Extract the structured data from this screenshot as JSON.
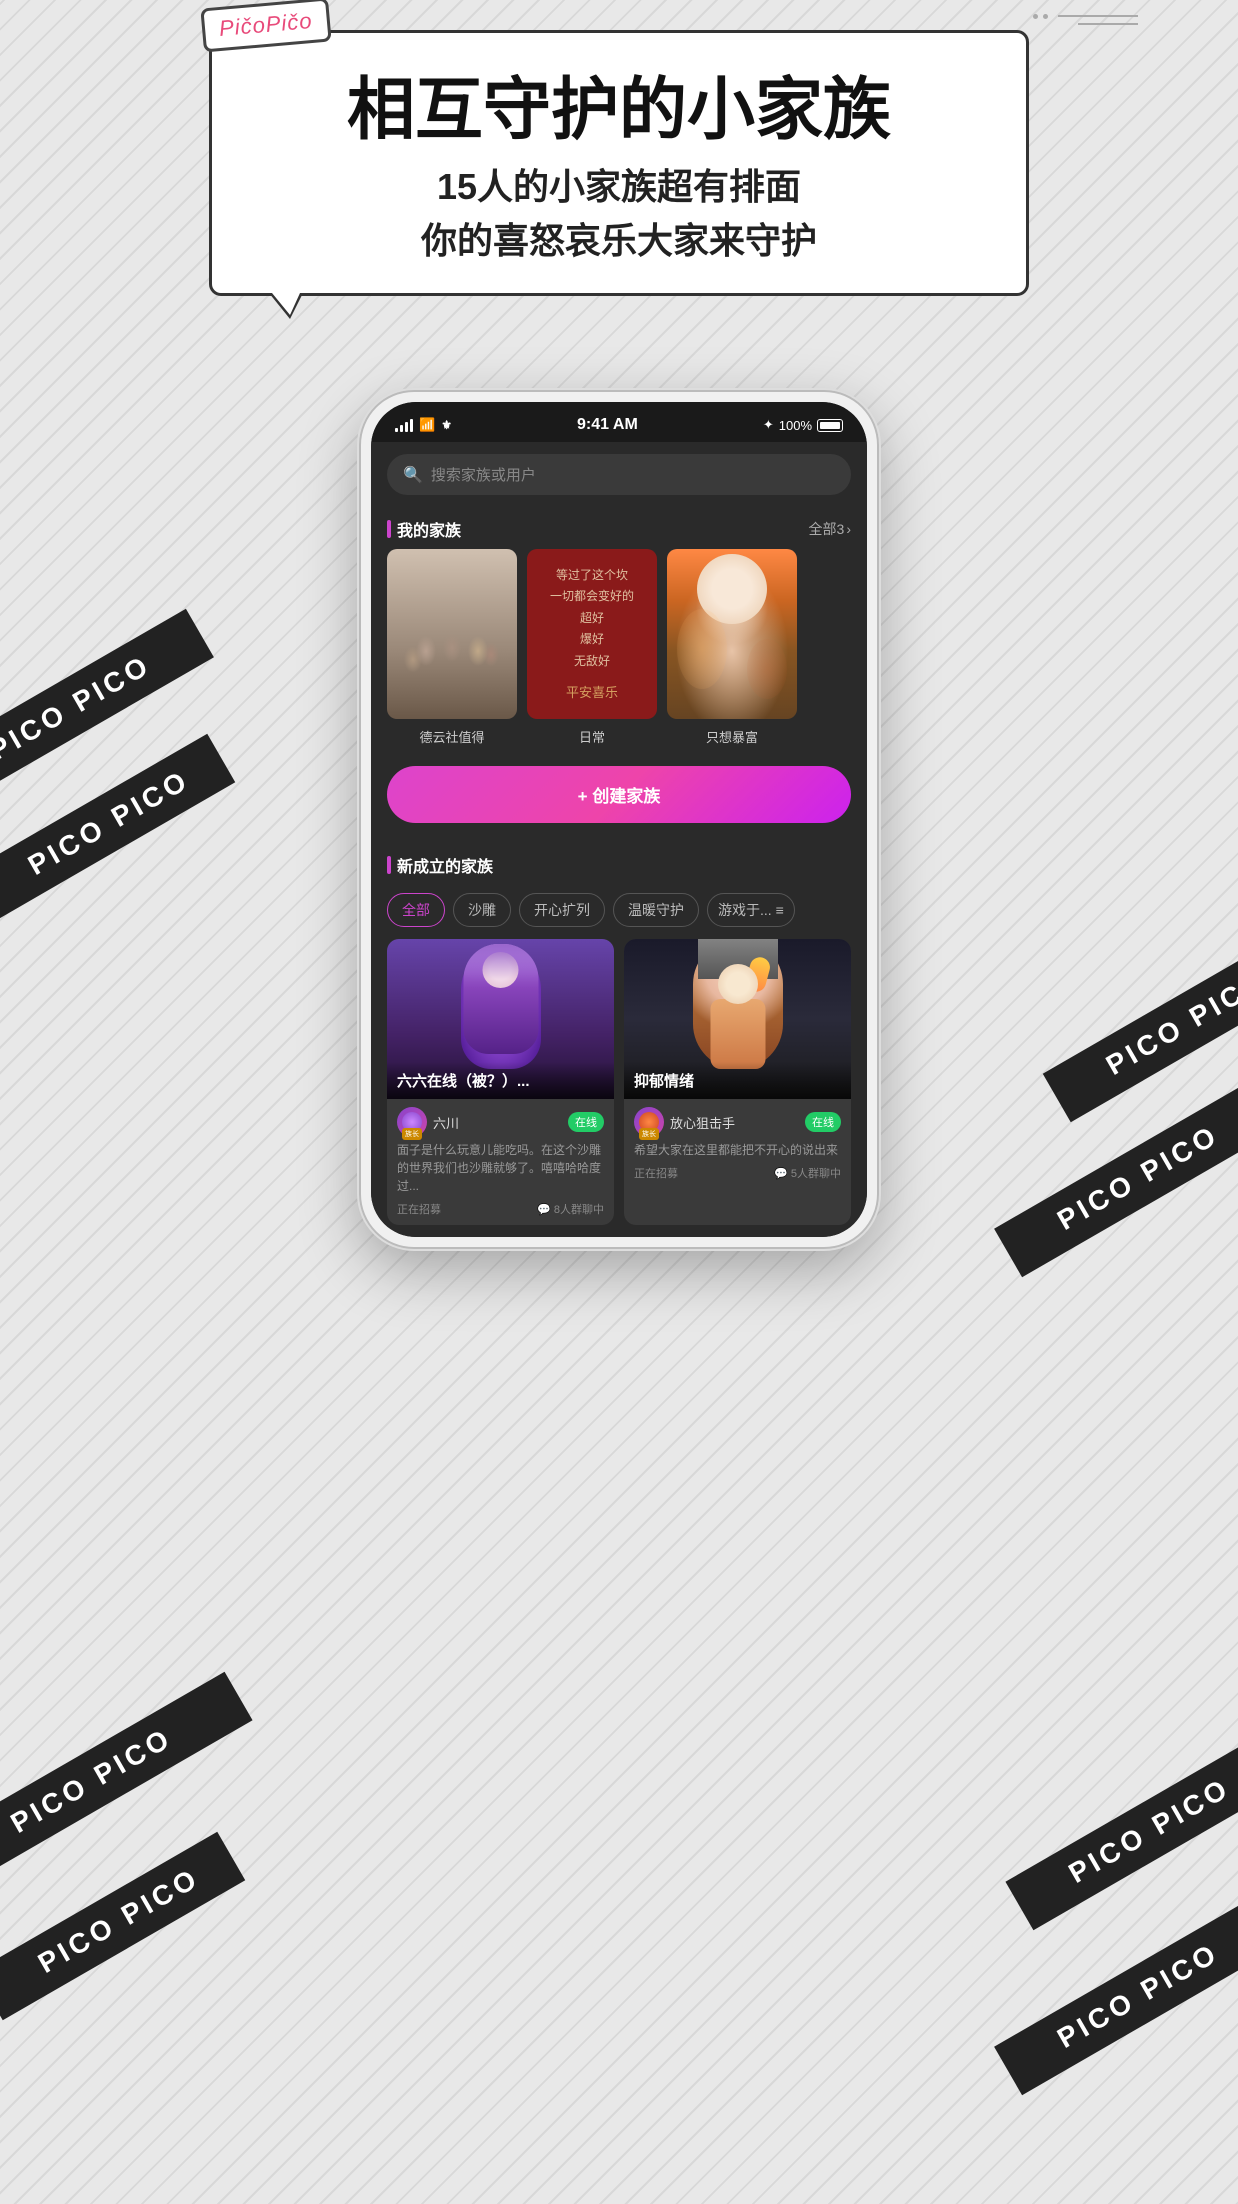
{
  "background": {
    "color": "#e0e0e0"
  },
  "logo": {
    "text": "PičoPičo"
  },
  "hero": {
    "title": "相互守护的小家族",
    "subtitle_line1": "15人的小家族超有排面",
    "subtitle_line2": "你的喜怒哀乐大家来守护"
  },
  "status_bar": {
    "time": "9:41 AM",
    "battery": "100%",
    "bluetooth": "✦"
  },
  "search": {
    "placeholder": "搜索家族或用户"
  },
  "my_family": {
    "title": "我的家族",
    "more": "全部3",
    "cards": [
      {
        "name": "德云社值得",
        "type": "group_photo"
      },
      {
        "name": "日常",
        "type": "text_card",
        "lines": [
          "等过了这个坎",
          "一切都会变好的",
          "超好",
          "爆好",
          "无敌好"
        ],
        "bottom": "平安喜乐"
      },
      {
        "name": "只想暴富",
        "type": "anime_girl"
      }
    ]
  },
  "create_button": {
    "label": "+ 创建家族"
  },
  "new_families": {
    "title": "新成立的家族",
    "filters": [
      "全部",
      "沙雕",
      "开心扩列",
      "温暖守护",
      "游戏于..."
    ],
    "cards": [
      {
        "title": "六六在线（被？）...",
        "owner_name": "六川",
        "owner_badge": "族长",
        "online_status": "在线",
        "description": "面子是什么玩意儿能吃吗。在这个沙雕的世界我们也沙雕就够了。嘻嘻哈哈度过...",
        "recruiting": "正在招募",
        "chat_count": "8人群聊中"
      },
      {
        "title": "抑郁情绪",
        "owner_name": "放心狙击手",
        "owner_badge": "族长",
        "online_status": "在线",
        "description": "希望大家在这里都能把不开心的说出来",
        "recruiting": "正在招募",
        "chat_count": "5人群聊中"
      }
    ]
  },
  "pico_banners": [
    "PICO PICO",
    "PICO PICO",
    "PICO PICO",
    "PICO PICO",
    "PICO PICO",
    "PICO PICO",
    "PICO PICO",
    "PICO PICO"
  ]
}
